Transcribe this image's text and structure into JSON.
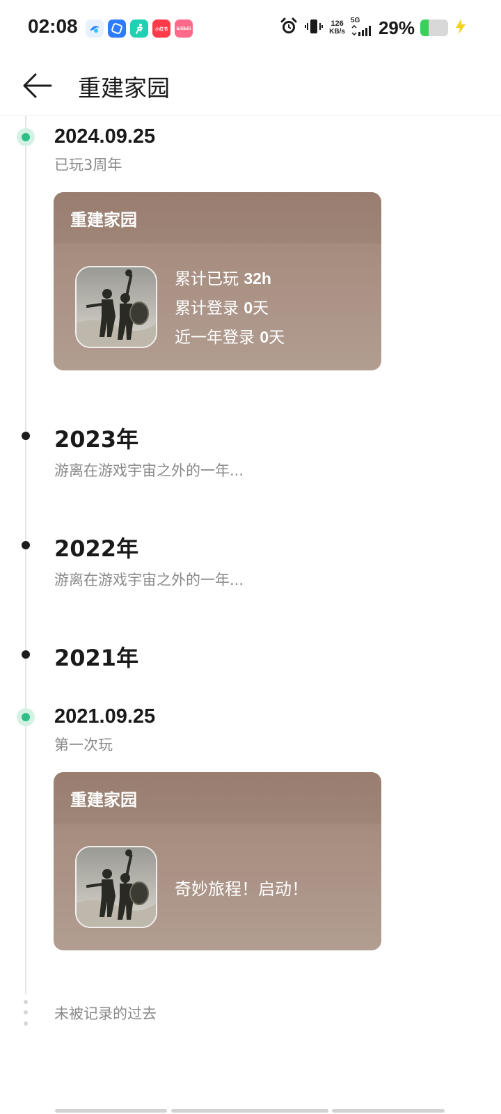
{
  "status_bar": {
    "time": "02:08",
    "apps": [
      {
        "name": "qq-browser-app-icon",
        "color": "#e8f1ff",
        "glyph": ""
      },
      {
        "name": "blue-app-icon",
        "color": "#2d7cff",
        "glyph": ""
      },
      {
        "name": "fitness-app-icon",
        "color": "#1fd0b2",
        "glyph": ""
      },
      {
        "name": "xiaohongshu-app-icon",
        "color": "#ff3b4a",
        "glyph": "小红书"
      },
      {
        "name": "bilibili-app-icon",
        "color": "#ff6a8a",
        "glyph": "bilibili"
      }
    ],
    "net_speed": "126",
    "net_unit": "KB/s",
    "signal_label": "5G",
    "battery_pct": "29%",
    "battery_level": 0.29
  },
  "header": {
    "title": "重建家园"
  },
  "timeline": {
    "entry_2024": {
      "date": "2024.09.25",
      "subtitle": "已玩3周年",
      "card_title": "重建家园",
      "stats": [
        {
          "label": "累计已玩 ",
          "value": "32h",
          "suffix": ""
        },
        {
          "label": "累计登录 ",
          "value": "0",
          "suffix": "天"
        },
        {
          "label": "近一年登录 ",
          "value": "0",
          "suffix": "天"
        }
      ]
    },
    "year_2023": {
      "year": "2023年",
      "subtitle": "游离在游戏宇宙之外的一年..."
    },
    "year_2022": {
      "year": "2022年",
      "subtitle": "游离在游戏宇宙之外的一年..."
    },
    "year_2021": {
      "year": "2021年"
    },
    "entry_2021": {
      "date": "2021.09.25",
      "subtitle": "第一次玩",
      "card_title": "重建家园",
      "message": "奇妙旅程！启动！"
    },
    "footer": "未被记录的过去"
  },
  "colors": {
    "card_top": "#a08577",
    "card_bottom": "#b29d91",
    "accent_green": "#2fc088"
  }
}
